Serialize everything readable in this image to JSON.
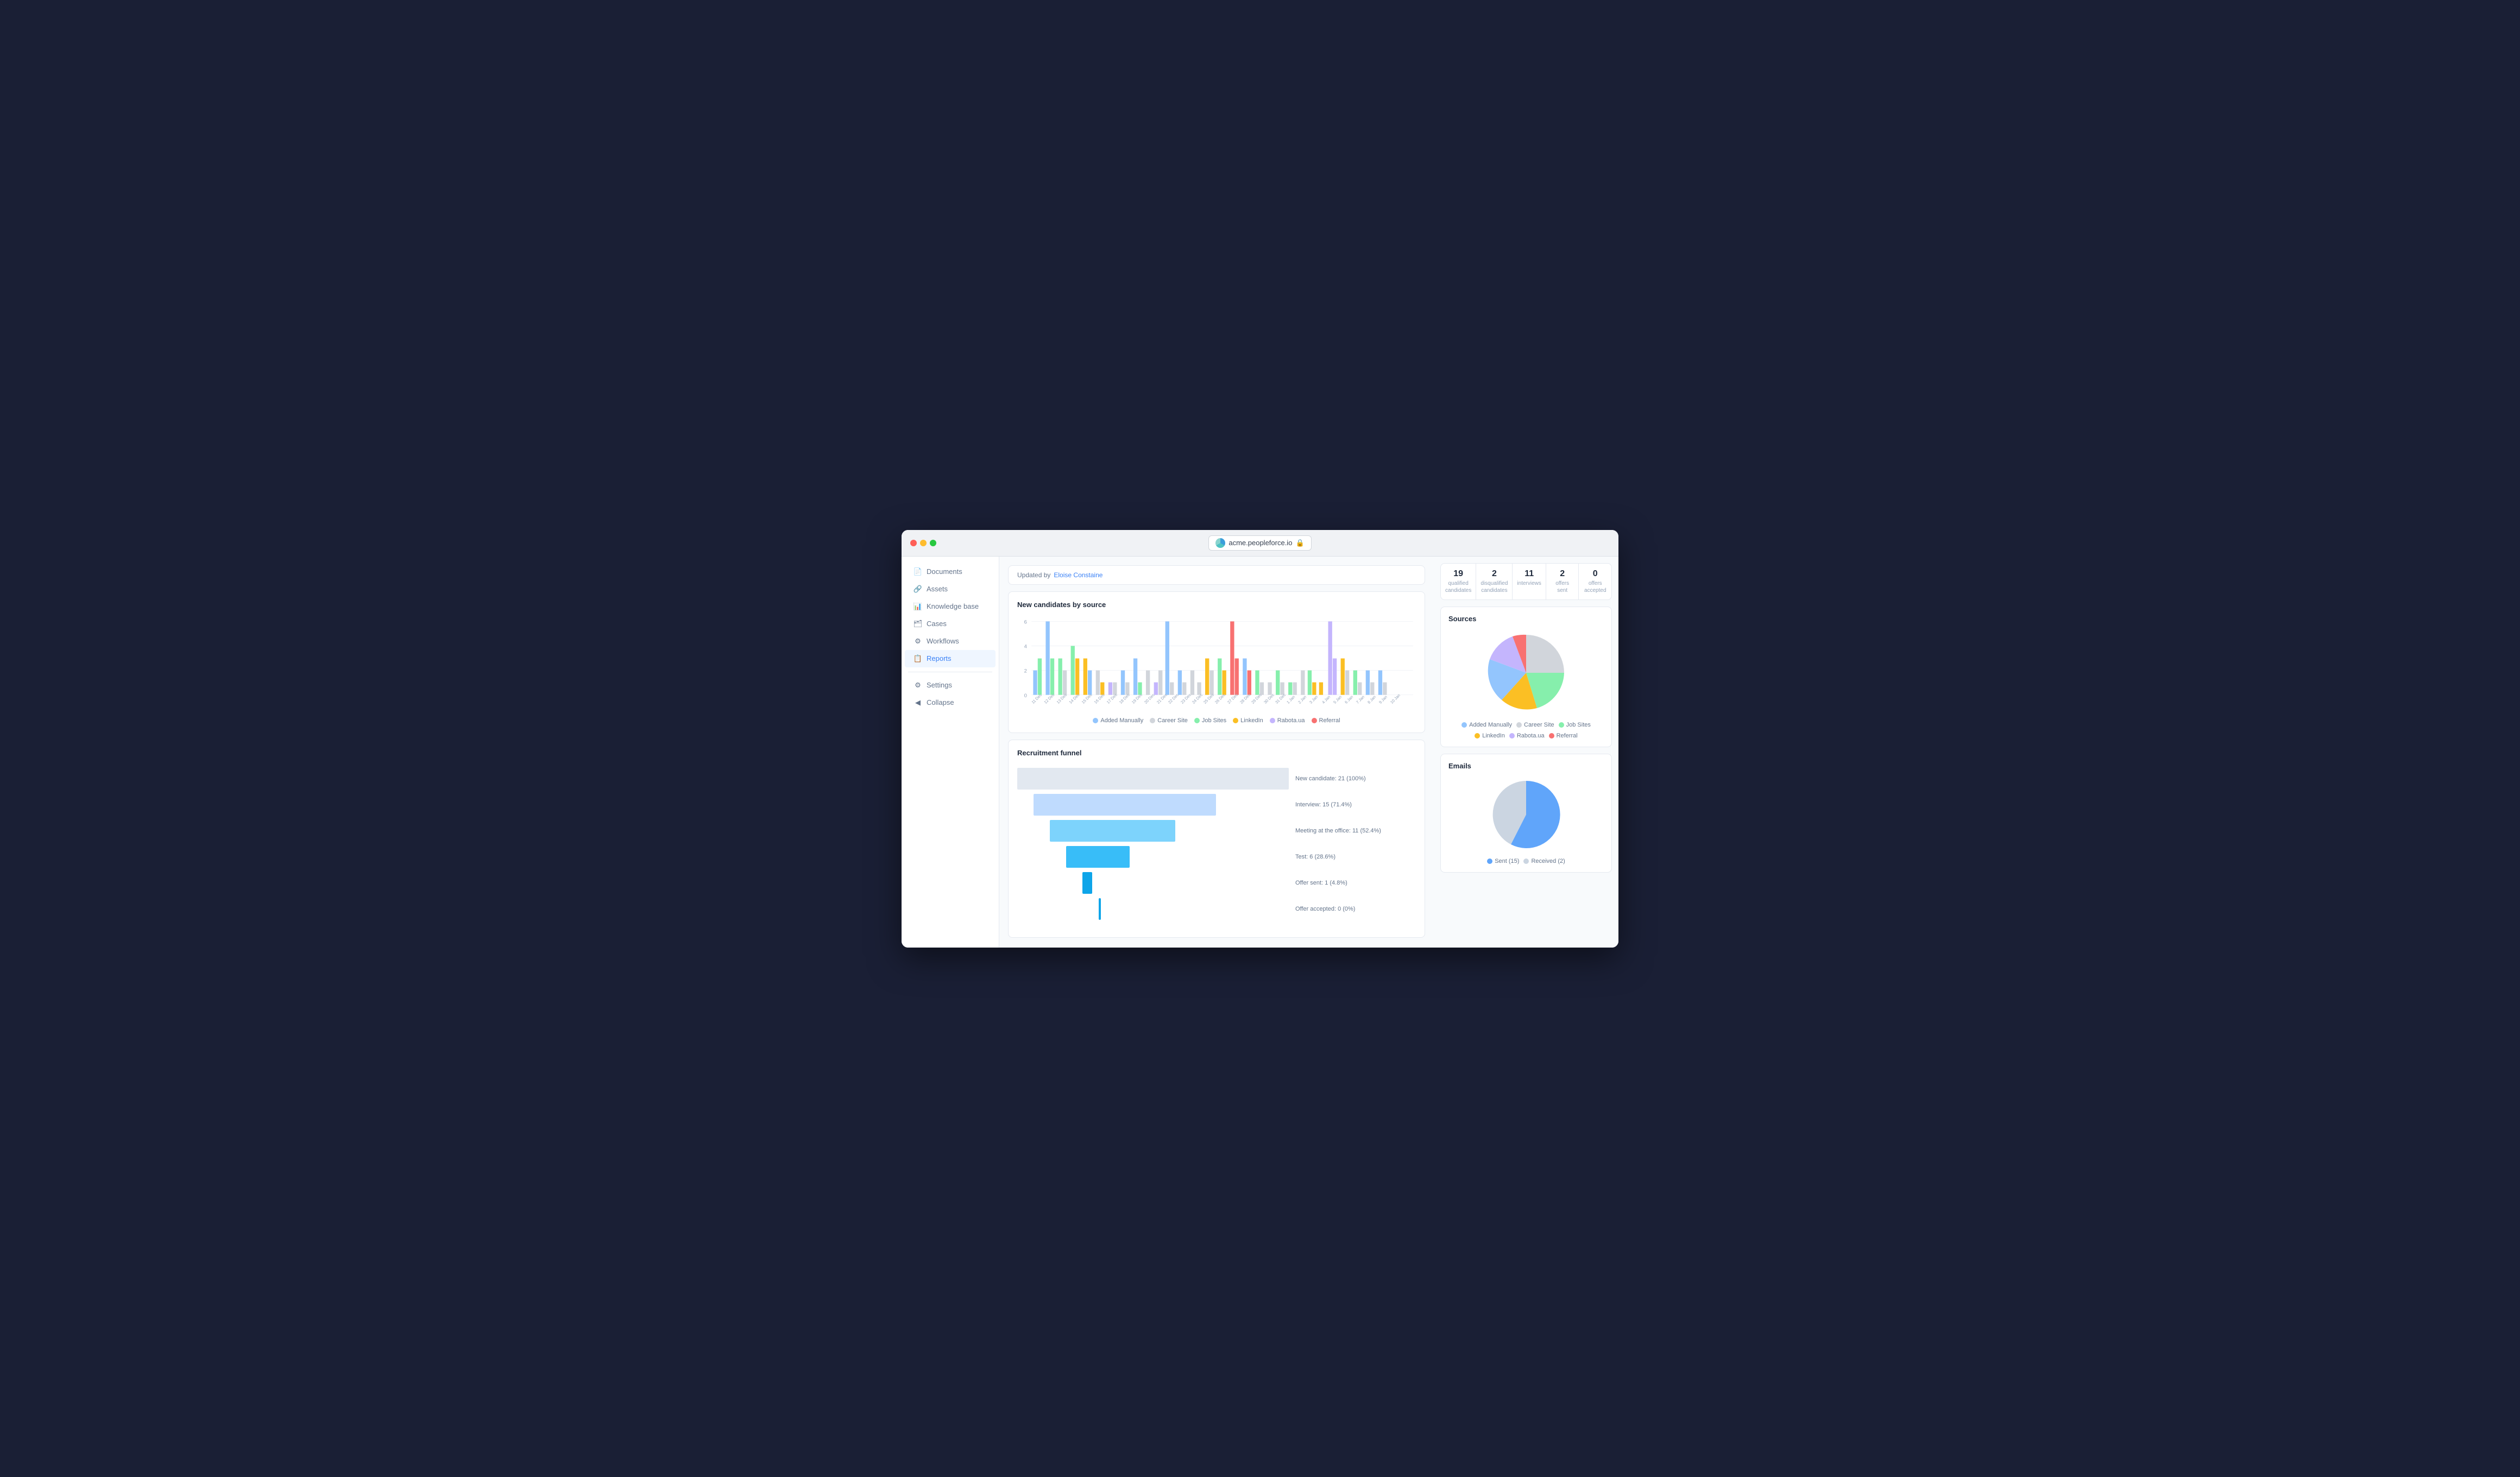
{
  "browser": {
    "url": "acme.peopleforce.io",
    "lock_icon": "🔒"
  },
  "sidebar": {
    "items": [
      {
        "id": "documents",
        "label": "Documents",
        "icon": "📄",
        "active": false
      },
      {
        "id": "assets",
        "label": "Assets",
        "icon": "🔗",
        "active": false
      },
      {
        "id": "knowledge-base",
        "label": "Knowledge base",
        "icon": "📊",
        "active": false
      },
      {
        "id": "cases",
        "label": "Cases",
        "icon": "🗂",
        "active": false
      },
      {
        "id": "workflows",
        "label": "Workflows",
        "icon": "⚙",
        "active": false
      },
      {
        "id": "reports",
        "label": "Reports",
        "icon": "📋",
        "active": true
      }
    ],
    "bottom_items": [
      {
        "id": "settings",
        "label": "Settings",
        "icon": "⚙"
      },
      {
        "id": "collapse",
        "label": "Collapse",
        "icon": "◀"
      }
    ]
  },
  "updated_by": {
    "label": "Updated by",
    "author": "Eloise Constaine"
  },
  "candidates_chart": {
    "title": "New candidates by source",
    "legend": [
      {
        "label": "Added Manually",
        "color": "#93c5fd"
      },
      {
        "label": "Career Site",
        "color": "#d1d5db"
      },
      {
        "label": "Job Sites",
        "color": "#86efac"
      },
      {
        "label": "LinkedIn",
        "color": "#fbbf24"
      },
      {
        "label": "Rabota.ua",
        "color": "#c4b5fd"
      },
      {
        "label": "Referral",
        "color": "#f87171"
      }
    ],
    "x_labels": [
      "11 Dec",
      "12 Dec",
      "13 Dec",
      "14 Dec",
      "15 Dec",
      "16 Dec",
      "17 Dec",
      "18 Dec",
      "19 Dec",
      "20 Dec",
      "21 Dec",
      "22 Dec",
      "23 Dec",
      "24 Dec",
      "25 Dec",
      "26 Dec",
      "27 Dec",
      "28 Dec",
      "29 Dec",
      "30 Dec",
      "31 Dec",
      "1 Jan",
      "2 Jan",
      "3 Jan",
      "4 Jan",
      "5 Jan",
      "6 Jan",
      "7 Jan",
      "8 Jan",
      "9 Jan",
      "10 Jan"
    ]
  },
  "stats": {
    "qualified_candidates": {
      "number": "19",
      "label": "qualified candidates"
    },
    "disqualified_candidates": {
      "number": "2",
      "label": "disqualified candidates"
    },
    "interviews": {
      "number": "11",
      "label": "interviews"
    },
    "offers_sent": {
      "number": "2",
      "label": "offers sent"
    },
    "offers_accepted": {
      "number": "0",
      "label": "offers accepted"
    }
  },
  "sources_chart": {
    "title": "Sources",
    "legend": [
      {
        "label": "Added Manually",
        "color": "#93c5fd"
      },
      {
        "label": "Career Site",
        "color": "#d1d5db"
      },
      {
        "label": "Job Sites",
        "color": "#86efac"
      },
      {
        "label": "LinkedIn",
        "color": "#fbbf24"
      },
      {
        "label": "Rabota.ua",
        "color": "#c4b5fd"
      },
      {
        "label": "Referral",
        "color": "#f87171"
      }
    ]
  },
  "emails_chart": {
    "title": "Emails",
    "legend": [
      {
        "label": "Sent (15)",
        "color": "#60a5fa"
      },
      {
        "label": "Received (2)",
        "color": "#cbd5e1"
      }
    ]
  },
  "funnel": {
    "title": "Recruitment funnel",
    "stages": [
      {
        "label": "New candidate: 21 (100%)",
        "pct": 100,
        "color": "#e2e8f0"
      },
      {
        "label": "Interview: 15 (71.4%)",
        "pct": 71.4,
        "color": "#bfdbfe"
      },
      {
        "label": "Meeting at the office: 11 (52.4%)",
        "pct": 52.4,
        "color": "#7dd3fc"
      },
      {
        "label": "Test: 6 (28.6%)",
        "pct": 28.6,
        "color": "#38bdf8"
      },
      {
        "label": "Offer sent: 1 (4.8%)",
        "pct": 4.8,
        "color": "#0ea5e9"
      },
      {
        "label": "Offer accepted: 0 (0%)",
        "pct": 0.5,
        "color": "#0ea5e9"
      }
    ]
  }
}
